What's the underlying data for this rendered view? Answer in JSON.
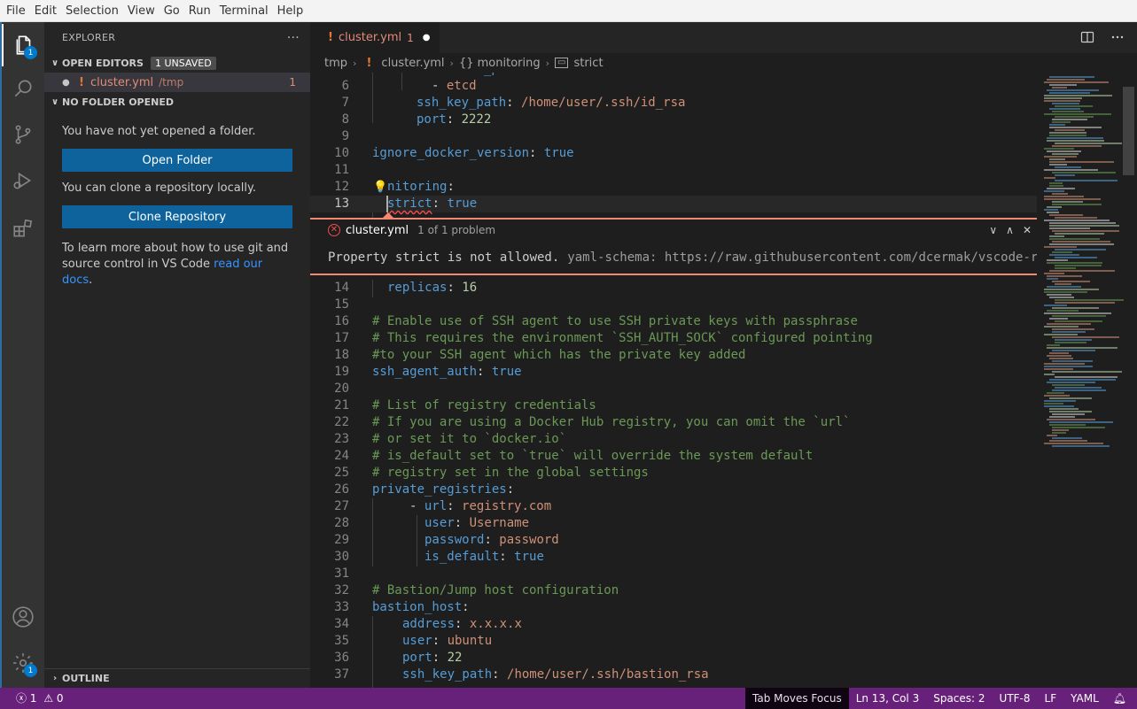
{
  "menu": [
    "File",
    "Edit",
    "Selection",
    "View",
    "Go",
    "Run",
    "Terminal",
    "Help"
  ],
  "activity_bar": {
    "explorer_badge": "1",
    "settings_badge": "1"
  },
  "sidebar": {
    "title": "EXPLORER",
    "more_actions": "···",
    "open_editors": {
      "label": "OPEN EDITORS",
      "badge": "1 UNSAVED",
      "item": {
        "dot": "●",
        "icon": "!",
        "name": "cluster.yml",
        "path": "/tmp",
        "count": "1"
      }
    },
    "no_folder": {
      "label": "NO FOLDER OPENED",
      "text1": "You have not yet opened a folder.",
      "open_folder": "Open Folder",
      "text2": "You can clone a repository locally.",
      "clone_repo": "Clone Repository",
      "text3": "To learn more about how to use git and source control in VS Code ",
      "link": "read our docs",
      "text3_end": "."
    },
    "outline": "OUTLINE"
  },
  "tab": {
    "icon": "!",
    "name": "cluster.yml",
    "count": "1",
    "dot": "●"
  },
  "breadcrumb": {
    "folder": "tmp",
    "file": "cluster.yml",
    "section": "{} monitoring",
    "key": "strict"
  },
  "peek": {
    "file": "cluster.yml",
    "summary": "1 of 1 problem",
    "message": "Property strict is not allowed.",
    "source": "yaml-schema: https://raw.githubusercontent.com/dcermak/vscode-r"
  },
  "code": {
    "l6": {
      "num": "6",
      "dash": "- ",
      "val": "etcd"
    },
    "l7": {
      "num": "7",
      "key": "ssh_key_path",
      "colon": ": ",
      "val": "/home/user/.ssh/id_rsa"
    },
    "l8": {
      "num": "8",
      "key": "port",
      "colon": ": ",
      "val": "2222"
    },
    "l9": {
      "num": "9"
    },
    "l10": {
      "num": "10",
      "key": "ignore_docker_version",
      "colon": ": ",
      "val": "true"
    },
    "l11": {
      "num": "11"
    },
    "l12": {
      "num": "12",
      "key": "nitoring",
      "colon": ":"
    },
    "l13": {
      "num": "13",
      "key": "strict",
      "colon": ": ",
      "val": "true"
    },
    "l14": {
      "num": "14",
      "key": "replicas",
      "colon": ": ",
      "val": "16"
    },
    "l15": {
      "num": "15"
    },
    "l16": {
      "num": "16",
      "comment": "# Enable use of SSH agent to use SSH private keys with passphrase"
    },
    "l17": {
      "num": "17",
      "comment": "# This requires the environment `SSH_AUTH_SOCK` configured pointing"
    },
    "l18": {
      "num": "18",
      "comment": "#to your SSH agent which has the private key added"
    },
    "l19": {
      "num": "19",
      "key": "ssh_agent_auth",
      "colon": ": ",
      "val": "true"
    },
    "l20": {
      "num": "20"
    },
    "l21": {
      "num": "21",
      "comment": "# List of registry credentials"
    },
    "l22": {
      "num": "22",
      "comment": "# If you are using a Docker Hub registry, you can omit the `url`"
    },
    "l23": {
      "num": "23",
      "comment": "# or set it to `docker.io`"
    },
    "l24": {
      "num": "24",
      "comment": "# is_default set to `true` will override the system default"
    },
    "l25": {
      "num": "25",
      "comment": "# registry set in the global settings"
    },
    "l26": {
      "num": "26",
      "key": "private_registries",
      "colon": ":"
    },
    "l27": {
      "num": "27",
      "dash": "- ",
      "key": "url",
      "colon": ": ",
      "val": "registry.com"
    },
    "l28": {
      "num": "28",
      "key": "user",
      "colon": ": ",
      "val": "Username"
    },
    "l29": {
      "num": "29",
      "key": "password",
      "colon": ": ",
      "val": "password"
    },
    "l30": {
      "num": "30",
      "key": "is_default",
      "colon": ": ",
      "val": "true"
    },
    "l31": {
      "num": "31"
    },
    "l32": {
      "num": "32",
      "comment": "# Bastion/Jump host configuration"
    },
    "l33": {
      "num": "33",
      "key": "bastion_host",
      "colon": ":"
    },
    "l34": {
      "num": "34",
      "key": "address",
      "colon": ": ",
      "val": "x.x.x.x"
    },
    "l35": {
      "num": "35",
      "key": "user",
      "colon": ": ",
      "val": "ubuntu"
    },
    "l36": {
      "num": "36",
      "key": "port",
      "colon": ": ",
      "val": "22"
    },
    "l37": {
      "num": "37",
      "key": "ssh_key_path",
      "colon": ": ",
      "val": "/home/user/.ssh/bastion_rsa"
    }
  },
  "statusbar": {
    "errors": "1",
    "warnings": "0",
    "tab_moves_focus": "Tab Moves Focus",
    "position": "Ln 13, Col 3",
    "spaces": "Spaces: 2",
    "encoding": "UTF-8",
    "eol": "LF",
    "language": "YAML"
  },
  "colors": {
    "status_bar": "#68217a",
    "error": "#f48771",
    "button": "#0e639c"
  }
}
